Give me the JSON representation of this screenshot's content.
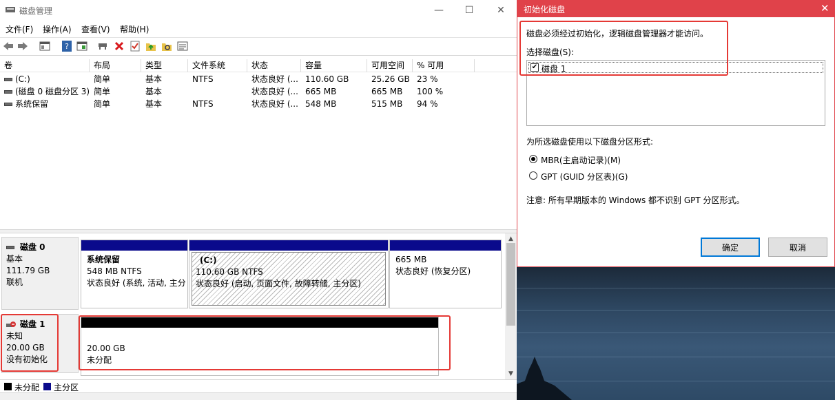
{
  "main_window": {
    "title": "磁盘管理",
    "controls": {
      "minimize": "—",
      "maximize": "☐",
      "close": "✕"
    },
    "menu": [
      "文件(F)",
      "操作(A)",
      "查看(V)",
      "帮助(H)"
    ],
    "toolbar_icons": [
      "back-icon",
      "forward-icon",
      "properties-icon",
      "help-icon",
      "console-icon",
      "connect-icon",
      "delete-icon",
      "check-icon",
      "up-icon",
      "search-icon",
      "list-icon"
    ]
  },
  "volume_table": {
    "columns": [
      "卷",
      "布局",
      "类型",
      "文件系统",
      "状态",
      "容量",
      "可用空间",
      "% 可用"
    ],
    "rows": [
      [
        "(C:)",
        "简单",
        "基本",
        "NTFS",
        "状态良好 (...",
        "110.60 GB",
        "25.26 GB",
        "23 %"
      ],
      [
        "(磁盘 0 磁盘分区 3)",
        "简单",
        "基本",
        "",
        "状态良好 (...",
        "665 MB",
        "665 MB",
        "100 %"
      ],
      [
        "系统保留",
        "简单",
        "基本",
        "NTFS",
        "状态良好 (...",
        "548 MB",
        "515 MB",
        "94 %"
      ]
    ]
  },
  "disks": {
    "disk0": {
      "name": "磁盘 0",
      "type": "基本",
      "size": "111.79 GB",
      "status": "联机",
      "partitions": [
        {
          "title": "系统保留",
          "size": "548 MB NTFS",
          "status": "状态良好 (系统, 活动, 主分"
        },
        {
          "title": "(C:)",
          "size": "110.60 GB NTFS",
          "status": "状态良好 (启动, 页面文件, 故障转储, 主分区)"
        },
        {
          "title": "",
          "size": "665 MB",
          "status": "状态良好 (恢复分区)"
        }
      ]
    },
    "disk1": {
      "name": "磁盘 1",
      "type": "未知",
      "size": "20.00 GB",
      "status": "没有初始化",
      "partition": {
        "size": "20.00 GB",
        "status": "未分配"
      }
    }
  },
  "legend": {
    "unallocated": "未分配",
    "primary": "主分区"
  },
  "colors": {
    "primary_bar": "#0a0a8c",
    "unallocated_bar": "#000000",
    "highlight": "#e53935",
    "dialog_accent": "#e0424a",
    "default_button": "#0078d7"
  },
  "dialog": {
    "title": "初始化磁盘",
    "close": "✕",
    "message": "磁盘必须经过初始化，逻辑磁盘管理器才能访问。",
    "select_label": "选择磁盘(S):",
    "disks": [
      {
        "label": "磁盘 1",
        "checked": true
      }
    ],
    "partition_style_label": "为所选磁盘使用以下磁盘分区形式:",
    "options": [
      {
        "label": "MBR(主启动记录)(M)",
        "selected": true
      },
      {
        "label": "GPT (GUID 分区表)(G)",
        "selected": false
      }
    ],
    "note": "注意: 所有早期版本的 Windows 都不识别 GPT 分区形式。",
    "ok": "确定",
    "cancel": "取消"
  }
}
